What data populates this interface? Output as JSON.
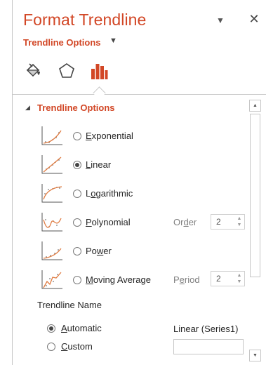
{
  "pane": {
    "title": "Format Trendline",
    "subtitle": "Trendline Options",
    "dropdown_icon": "caret-down-icon",
    "close_icon": "close-icon",
    "close_glyph": "✕",
    "dropdown_glyph": "▼",
    "accent_color": "#d24726"
  },
  "tabs": [
    {
      "icon": "fill-line-icon",
      "selected": false
    },
    {
      "icon": "effects-pentagon-icon",
      "selected": false
    },
    {
      "icon": "trendline-options-icon",
      "selected": true,
      "color": "#d24726"
    }
  ],
  "section": {
    "title": "Trendline Options",
    "caret_glyph": "◢"
  },
  "options": [
    {
      "key": "exponential",
      "label_pre": "",
      "label_u": "E",
      "label_post": "xponential",
      "checked": false,
      "icon": "exponential-trend-icon"
    },
    {
      "key": "linear",
      "label_pre": "",
      "label_u": "L",
      "label_post": "inear",
      "checked": true,
      "icon": "linear-trend-icon"
    },
    {
      "key": "logarithmic",
      "label_pre": "L",
      "label_u": "o",
      "label_post": "garithmic",
      "checked": false,
      "icon": "logarithmic-trend-icon"
    },
    {
      "key": "polynomial",
      "label_pre": "",
      "label_u": "P",
      "label_post": "olynomial",
      "checked": false,
      "icon": "polynomial-trend-icon",
      "param_pre": "Or",
      "param_u": "d",
      "param_post": "er",
      "param_value": "2"
    },
    {
      "key": "power",
      "label_pre": "Po",
      "label_u": "w",
      "label_post": "er",
      "checked": false,
      "icon": "power-trend-icon"
    },
    {
      "key": "moving_average",
      "label_pre": "",
      "label_u": "M",
      "label_post": "oving Average",
      "checked": false,
      "icon": "moving-average-trend-icon",
      "param_pre": "P",
      "param_u": "e",
      "param_post": "riod",
      "param_value": "2"
    }
  ],
  "trendline_name": {
    "label": "Trendline Name",
    "automatic_u": "A",
    "automatic_post": "utomatic",
    "custom_u": "C",
    "custom_post": "ustom",
    "automatic_checked": true,
    "automatic_value": "Linear (Series1)",
    "custom_value": ""
  },
  "scrollbar": {
    "up_glyph": "▲",
    "down_glyph": "▼"
  }
}
